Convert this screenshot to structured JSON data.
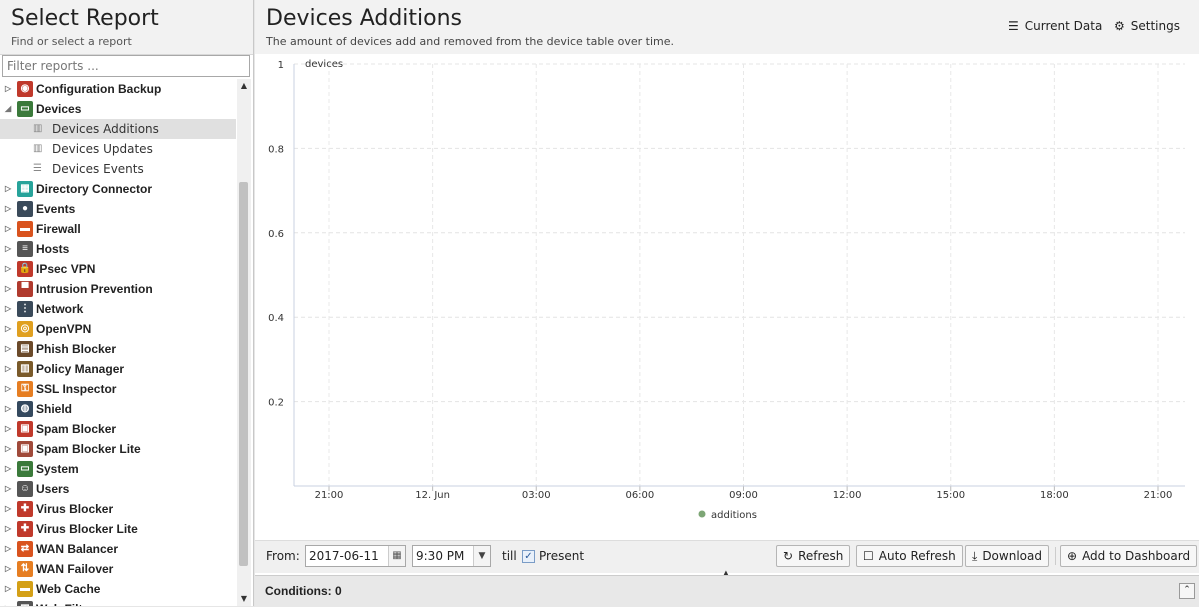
{
  "sidebar": {
    "title": "Select Report",
    "subtitle": "Find or select a report",
    "filter_placeholder": "Filter reports ...",
    "categories": [
      {
        "label": "Configuration Backup",
        "color": "#c0392b",
        "glyph": "◉",
        "expanded": false
      },
      {
        "label": "Devices",
        "color": "#3b7a3b",
        "glyph": "▭",
        "expanded": true
      },
      {
        "label": "Directory Connector",
        "color": "#27a39a",
        "glyph": "▦",
        "expanded": false
      },
      {
        "label": "Events",
        "color": "#3a4a5a",
        "glyph": "●",
        "expanded": false
      },
      {
        "label": "Firewall",
        "color": "#d9531e",
        "glyph": "▬",
        "expanded": false
      },
      {
        "label": "Hosts",
        "color": "#555555",
        "glyph": "≡",
        "expanded": false
      },
      {
        "label": "IPsec VPN",
        "color": "#c0392b",
        "glyph": "🔒",
        "expanded": false
      },
      {
        "label": "Intrusion Prevention",
        "color": "#b03a2e",
        "glyph": "▀",
        "expanded": false
      },
      {
        "label": "Network",
        "color": "#3a4a5a",
        "glyph": "⋮",
        "expanded": false
      },
      {
        "label": "OpenVPN",
        "color": "#e0a020",
        "glyph": "◎",
        "expanded": false
      },
      {
        "label": "Phish Blocker",
        "color": "#6b4a2a",
        "glyph": "▤",
        "expanded": false
      },
      {
        "label": "Policy Manager",
        "color": "#7a5a2a",
        "glyph": "▥",
        "expanded": false
      },
      {
        "label": "SSL Inspector",
        "color": "#e67e22",
        "glyph": "⚿",
        "expanded": false
      },
      {
        "label": "Shield",
        "color": "#34495e",
        "glyph": "◍",
        "expanded": false
      },
      {
        "label": "Spam Blocker",
        "color": "#c0392b",
        "glyph": "▣",
        "expanded": false
      },
      {
        "label": "Spam Blocker Lite",
        "color": "#a04a3a",
        "glyph": "▣",
        "expanded": false
      },
      {
        "label": "System",
        "color": "#3b7a3b",
        "glyph": "▭",
        "expanded": false
      },
      {
        "label": "Users",
        "color": "#555555",
        "glyph": "☺",
        "expanded": false
      },
      {
        "label": "Virus Blocker",
        "color": "#c0392b",
        "glyph": "✚",
        "expanded": false
      },
      {
        "label": "Virus Blocker Lite",
        "color": "#c0392b",
        "glyph": "✚",
        "expanded": false
      },
      {
        "label": "WAN Balancer",
        "color": "#d9531e",
        "glyph": "⇄",
        "expanded": false
      },
      {
        "label": "WAN Failover",
        "color": "#e67e22",
        "glyph": "⇅",
        "expanded": false
      },
      {
        "label": "Web Cache",
        "color": "#d4a017",
        "glyph": "▬",
        "expanded": false
      },
      {
        "label": "Web Filter",
        "color": "#555555",
        "glyph": "▦",
        "expanded": false
      }
    ],
    "device_reports": [
      {
        "label": "Devices Additions",
        "icon": "bar-chart-icon",
        "selected": true
      },
      {
        "label": "Devices Updates",
        "icon": "bar-chart-icon",
        "selected": false
      },
      {
        "label": "Devices Events",
        "icon": "list-icon",
        "selected": false
      }
    ]
  },
  "report": {
    "title": "Devices Additions",
    "description": "The amount of devices add and removed from the device table over time.",
    "current_data_label": "Current Data",
    "settings_label": "Settings"
  },
  "chart_data": {
    "type": "line",
    "ylabel": "devices",
    "ylim": [
      0,
      1
    ],
    "y_ticks": [
      "1",
      "0.8",
      "0.6",
      "0.4",
      "0.2"
    ],
    "x_ticks": [
      "21:00",
      "12. Jun",
      "03:00",
      "06:00",
      "09:00",
      "12:00",
      "15:00",
      "18:00",
      "21:00"
    ],
    "series": [
      {
        "name": "additions",
        "color": "#7da675",
        "values": []
      }
    ],
    "grid": true,
    "legend": "bottom"
  },
  "controls": {
    "from_label": "From:",
    "date_value": "2017-06-11",
    "time_value": "9:30 PM",
    "till_label": "till",
    "present_label": "Present",
    "present_checked": "✓",
    "refresh_label": "Refresh",
    "auto_refresh_label": "Auto Refresh",
    "download_label": "Download",
    "add_dashboard_label": "Add to Dashboard"
  },
  "conditions": {
    "label": "Conditions: 0"
  }
}
